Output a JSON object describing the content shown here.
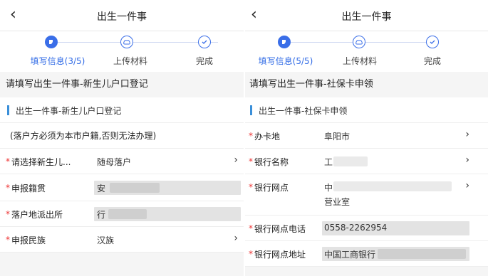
{
  "left": {
    "header": {
      "back_icon": "chevron-left-icon",
      "title": "出生一件事"
    },
    "steps": [
      {
        "label": "填写信息(3/5)",
        "state": "active",
        "icon": "edit-icon"
      },
      {
        "label": "上传材料",
        "state": "pending",
        "icon": "cloud-upload-icon"
      },
      {
        "label": "完成",
        "state": "pending",
        "icon": "check-icon"
      }
    ],
    "section_title": "请填写出生一件事-新生儿户口登记",
    "sub_header": "出生一件事-新生儿户口登记",
    "notice": "(落户方必须为本市户籍,否则无法办理)",
    "fields": [
      {
        "label": "请选择新生儿...",
        "value": "随母落户"
      },
      {
        "label": "申报籍贯",
        "value": "安"
      },
      {
        "label": "落户地派出所",
        "value": "行"
      },
      {
        "label": "申报民族",
        "value": "汉族"
      }
    ]
  },
  "right": {
    "header": {
      "back_icon": "chevron-left-icon",
      "title": "出生一件事"
    },
    "steps": [
      {
        "label": "填写信息(5/5)",
        "state": "active",
        "icon": "edit-icon"
      },
      {
        "label": "上传材料",
        "state": "pending",
        "icon": "cloud-upload-icon"
      },
      {
        "label": "完成",
        "state": "pending",
        "icon": "check-icon"
      }
    ],
    "section_title": "请填写出生一件事-社保卡申领",
    "sub_header": "出生一件事-社保卡申领",
    "fields": [
      {
        "label": "办卡地",
        "value": "阜阳市"
      },
      {
        "label": "银行名称",
        "value": "工"
      },
      {
        "label": "银行网点",
        "value": "中",
        "value2": "营业室"
      },
      {
        "label": "银行网点电话",
        "value": "0558-2262954"
      },
      {
        "label": "银行网点地址",
        "value": "中国工商银行"
      }
    ]
  },
  "colors": {
    "accent": "#3a6ee8",
    "required": "#e33333",
    "bar": "#3a8fd9"
  }
}
